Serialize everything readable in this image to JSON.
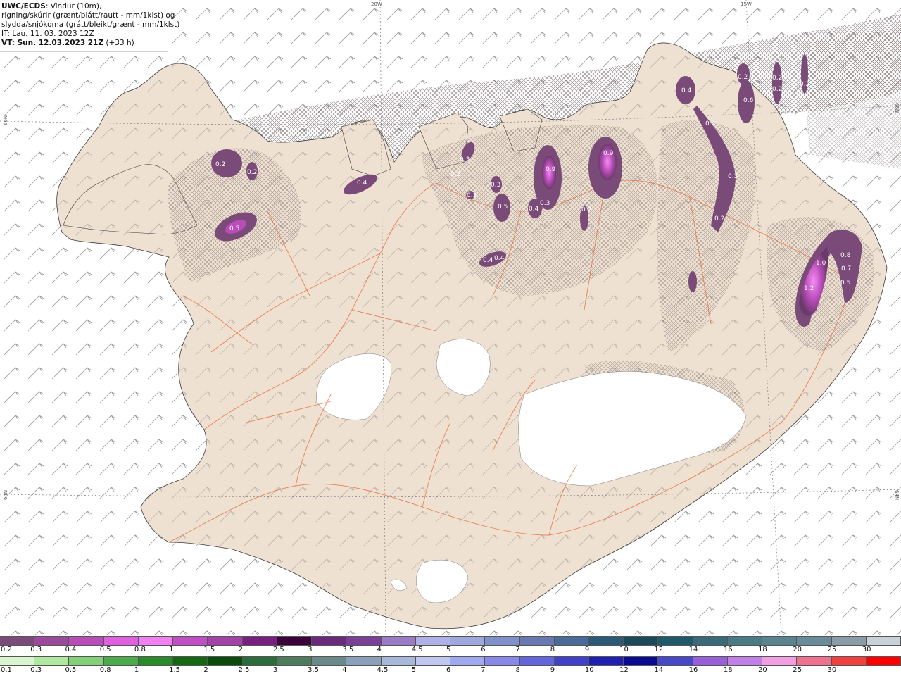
{
  "info": {
    "line1_bold": "UWC/ECDS",
    "line1_rest": ": Vindur (10m),",
    "line2": "rigning/skúrir (grænt/blátt/rautt - mm/1klst) og",
    "line3": "slydda/snjókoma (grátt/bleikt/grænt - mm/1klst)",
    "line4": "IT: Lau. 11. 03. 2023 12Z",
    "line5_bold": "VT: Sun. 12.03.2023 21Z",
    "line5_rest": " (+33 h)"
  },
  "grid_labels": [
    "20W",
    "15W",
    "66N",
    "66N",
    "64N",
    "64N"
  ],
  "precip_labels": [
    "0.2",
    "0.2",
    "0.5",
    "0.4",
    "0.2",
    "0.3",
    "0.3",
    "0.3",
    "0.5",
    "0.4",
    "0.4",
    "0.9",
    "0.3",
    "0.4",
    "0.9",
    "0.2",
    "0.4",
    "0.2",
    "0.2",
    "0.2",
    "0.2",
    "0.6",
    "0.4",
    "0.3",
    "0.2",
    "0.8",
    "1.0",
    "0.7",
    "0.5",
    "1.2"
  ],
  "legend_top": {
    "labels": [
      "0.2",
      "0.3",
      "0.4",
      "0.5",
      "0.8",
      "1",
      "1.5",
      "2",
      "2.5",
      "3",
      "3.5",
      "4",
      "4.5",
      "5",
      "6",
      "7",
      "8",
      "9",
      "10",
      "12",
      "14",
      "16",
      "18",
      "20",
      "25",
      "30"
    ],
    "colors": [
      "#7a4a78",
      "#9b4a9b",
      "#b94cb9",
      "#e05ee0",
      "#f17ff1",
      "#c14ec7",
      "#a342a8",
      "#7a1f82",
      "#3a0038",
      "#6a2a7c",
      "#7a4098",
      "#9a7cc6",
      "#b0b0e8",
      "#9fa8de",
      "#8090c8",
      "#6878b0",
      "#4a6a98",
      "#2a5a78",
      "#1a4a5a",
      "#1f5a6a",
      "#3a6a78",
      "#4a7a84",
      "#5a8490",
      "#6a8c98",
      "#8a9ca8",
      "#c8d0d8"
    ]
  },
  "legend_bottom": {
    "labels": [
      "0.1",
      "0.3",
      "0.5",
      "0.8",
      "1",
      "1.5",
      "2",
      "2.5",
      "3",
      "3.5",
      "4",
      "4.5",
      "5",
      "6",
      "7",
      "8",
      "9",
      "10",
      "12",
      "14",
      "16",
      "18",
      "20",
      "25",
      "30"
    ],
    "colors": [
      "#d8f5d0",
      "#b0e8a0",
      "#84d078",
      "#4caa4c",
      "#2a8a2a",
      "#146814",
      "#0a4a0a",
      "#2c6c3c",
      "#4c7c5c",
      "#6a8a8a",
      "#8aa0b8",
      "#a8b8d8",
      "#c0c8f0",
      "#a0a8f0",
      "#8888e8",
      "#6464dc",
      "#4040c8",
      "#2020b0",
      "#0a0a90",
      "#4848c8",
      "#9860d8",
      "#c080e8",
      "#f0a0e0",
      "#f07090",
      "#f04040",
      "#ff0000"
    ]
  }
}
